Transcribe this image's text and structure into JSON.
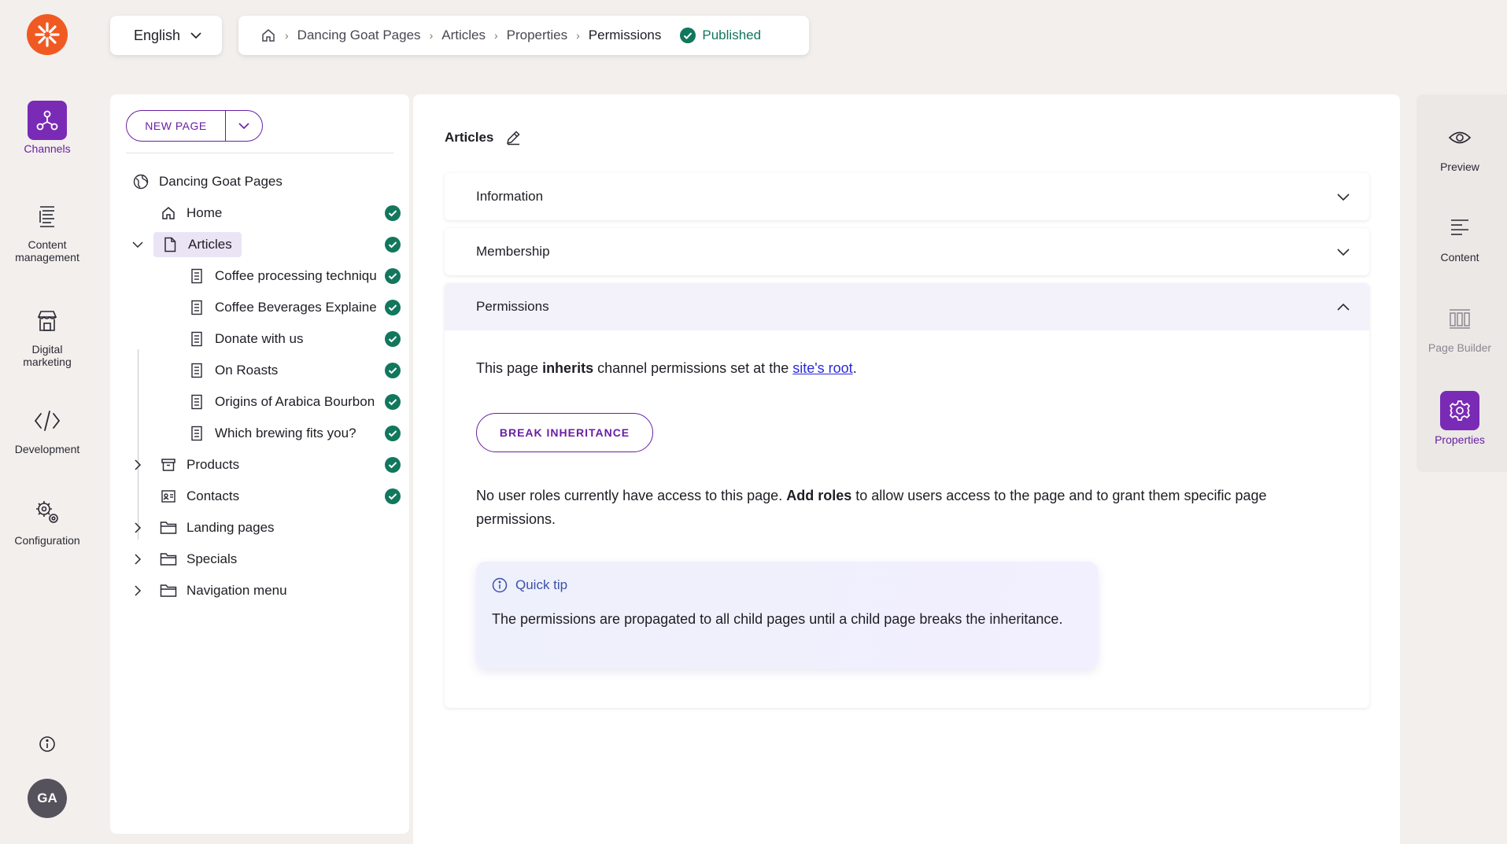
{
  "app": {
    "brand_color": "#f05a22",
    "accent_color": "#6a1fa3",
    "success_color": "#11775d"
  },
  "nav": {
    "items": [
      {
        "label": "Channels",
        "icon": "channels-icon",
        "active": true
      },
      {
        "label": "Content management",
        "icon": "content-management-icon",
        "active": false
      },
      {
        "label": "Digital marketing",
        "icon": "digital-marketing-icon",
        "active": false
      },
      {
        "label": "Development",
        "icon": "code-icon",
        "active": false
      },
      {
        "label": "Configuration",
        "icon": "gears-icon",
        "active": false
      }
    ],
    "avatar_initials": "GA"
  },
  "topbar": {
    "language": "English",
    "breadcrumb": [
      "Dancing Goat Pages",
      "Articles",
      "Properties",
      "Permissions"
    ],
    "status": "Published"
  },
  "tree": {
    "new_page_label": "NEW PAGE",
    "root": "Dancing Goat Pages",
    "items": [
      {
        "label": "Home",
        "icon": "home-icon",
        "published": true
      },
      {
        "label": "Articles",
        "icon": "page-icon",
        "published": true,
        "selected": true
      },
      {
        "label": "Coffee processing techniques",
        "icon": "article-icon",
        "published": true
      },
      {
        "label": "Coffee Beverages Explained",
        "icon": "article-icon",
        "published": true
      },
      {
        "label": "Donate with us",
        "icon": "article-icon",
        "published": true
      },
      {
        "label": "On Roasts",
        "icon": "article-icon",
        "published": true
      },
      {
        "label": "Origins of Arabica Bourbon",
        "icon": "article-icon",
        "published": true
      },
      {
        "label": "Which brewing fits you?",
        "icon": "article-icon",
        "published": true
      },
      {
        "label": "Products",
        "icon": "archive-icon",
        "published": true
      },
      {
        "label": "Contacts",
        "icon": "contacts-icon",
        "published": true
      },
      {
        "label": "Landing pages",
        "icon": "folder-icon",
        "published": false
      },
      {
        "label": "Specials",
        "icon": "folder-icon",
        "published": false
      },
      {
        "label": "Navigation menu",
        "icon": "folder-icon",
        "published": false
      }
    ]
  },
  "main": {
    "title": "Articles",
    "sections": [
      {
        "label": "Information",
        "expanded": false
      },
      {
        "label": "Membership",
        "expanded": false
      },
      {
        "label": "Permissions",
        "expanded": true
      }
    ],
    "permissions": {
      "inherit_pre": "This page ",
      "inherit_bold": "inherits",
      "inherit_mid": " channel permissions set at the ",
      "inherit_link": "site's root",
      "inherit_end": ".",
      "break_button": "BREAK INHERITANCE",
      "roles_pre": "No user roles currently have access to this page. ",
      "roles_bold": "Add roles",
      "roles_post": " to allow users access to the page and to grant them specific page permissions.",
      "tip_title": "Quick tip",
      "tip_text": "The permissions are propagated to all child pages until a child page breaks the inheritance."
    }
  },
  "right_panel": {
    "items": [
      {
        "label": "Preview",
        "icon": "eye-icon"
      },
      {
        "label": "Content",
        "icon": "content-icon"
      },
      {
        "label": "Page Builder",
        "icon": "page-builder-icon",
        "disabled": true
      },
      {
        "label": "Properties",
        "icon": "settings-icon",
        "active": true
      }
    ]
  }
}
